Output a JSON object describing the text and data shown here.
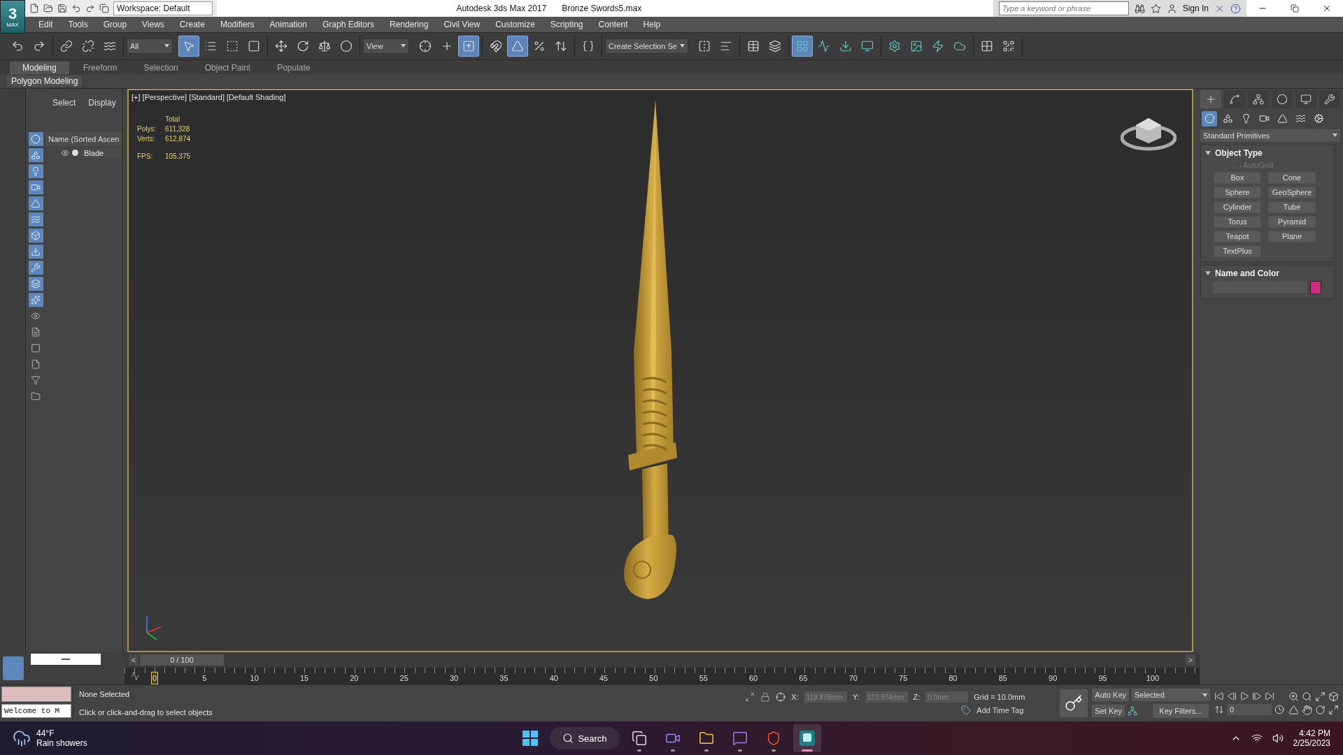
{
  "title_bar": {
    "logo": {
      "digit": "3",
      "label": "MAX"
    },
    "workspace": "Workspace: Default",
    "app": "Autodesk 3ds Max 2017",
    "file": "Bronze Swords5.max",
    "search_placeholder": "Type a keyword or phrase",
    "sign_in": "Sign In"
  },
  "menus": [
    "Edit",
    "Tools",
    "Group",
    "Views",
    "Create",
    "Modifiers",
    "Animation",
    "Graph Editors",
    "Rendering",
    "Civil View",
    "Customize",
    "Scripting",
    "Content",
    "Help"
  ],
  "main_toolbar": [
    {
      "kind": "group",
      "buttons": [
        {
          "selected": false
        },
        {
          "selected": false
        }
      ]
    },
    {
      "kind": "group",
      "buttons": [
        {
          "selected": false
        },
        {
          "selected": false
        },
        {
          "selected": false
        }
      ]
    },
    {
      "kind": "dropdown",
      "value": "All"
    },
    {
      "kind": "group",
      "buttons": [
        {
          "selected": true
        },
        {
          "selected": false
        },
        {
          "selected": false
        },
        {
          "selected": false
        }
      ]
    },
    {
      "kind": "group",
      "buttons": [
        {
          "selected": false
        },
        {
          "selected": false
        },
        {
          "selected": false
        },
        {
          "selected": false
        }
      ]
    },
    {
      "kind": "dropdown",
      "value": "View"
    },
    {
      "kind": "group",
      "buttons": [
        {
          "selected": false
        },
        {
          "selected": false
        },
        {
          "selected": true
        }
      ]
    },
    {
      "kind": "group",
      "buttons": [
        {
          "selected": false
        },
        {
          "selected": true
        },
        {
          "selected": false
        },
        {
          "selected": false
        }
      ]
    },
    {
      "kind": "group",
      "buttons": [
        {
          "selected": false
        }
      ]
    },
    {
      "kind": "dropdown",
      "value": "Create Selection Se"
    },
    {
      "kind": "group",
      "buttons": [
        {
          "selected": false
        },
        {
          "selected": false
        }
      ]
    },
    {
      "kind": "group",
      "buttons": [
        {
          "selected": false
        },
        {
          "selected": false
        }
      ]
    },
    {
      "kind": "group",
      "buttons": [
        {
          "selected": true
        },
        {
          "selected": false
        },
        {
          "selected": false
        },
        {
          "selected": false
        }
      ]
    },
    {
      "kind": "group",
      "buttons": [
        {
          "selected": false
        },
        {
          "selected": false
        },
        {
          "selected": false
        },
        {
          "selected": false
        }
      ]
    },
    {
      "kind": "group",
      "buttons": [
        {
          "selected": false
        },
        {
          "selected": false
        }
      ]
    }
  ],
  "ribbon": {
    "tabs": [
      {
        "label": "Modeling",
        "selected": true
      },
      {
        "label": "Freeform",
        "selected": false
      },
      {
        "label": "Selection",
        "selected": false
      },
      {
        "label": "Object Paint",
        "selected": false
      },
      {
        "label": "Populate",
        "selected": false
      }
    ],
    "panel": "Polygon Modeling"
  },
  "display_filters": [
    {
      "on": true
    },
    {
      "on": true
    },
    {
      "on": true
    },
    {
      "on": true
    },
    {
      "on": true
    },
    {
      "on": true
    },
    {
      "on": true
    },
    {
      "on": true
    },
    {
      "on": true
    },
    {
      "on": true
    },
    {
      "on": true
    },
    {
      "on": false
    },
    {
      "on": false
    },
    {
      "on": false
    },
    {
      "on": false
    },
    {
      "on": false
    },
    {
      "on": false
    }
  ],
  "scene_explorer": {
    "tabs": [
      "Select",
      "Display"
    ],
    "column": "Name (Sorted Ascen",
    "rows": [
      {
        "name": "Blade"
      }
    ]
  },
  "viewport": {
    "label": "[+] [Perspective] [Standard] [Default Shading]",
    "stats_header": "Total",
    "stats": [
      {
        "label": "Polys:",
        "value": "611,328"
      },
      {
        "label": "Verts:",
        "value": "612,874"
      }
    ],
    "fps": {
      "label": "FPS:",
      "value": "105.375"
    }
  },
  "command_panel": {
    "tabs": [
      {
        "selected": true
      },
      {
        "selected": false
      },
      {
        "selected": false
      },
      {
        "selected": false
      },
      {
        "selected": false
      },
      {
        "selected": false
      }
    ],
    "categories": [
      {
        "selected": true
      },
      {
        "selected": false
      },
      {
        "selected": false
      },
      {
        "selected": false
      },
      {
        "selected": false
      },
      {
        "selected": false
      },
      {
        "selected": false
      }
    ],
    "dropdown": "Standard Primitives",
    "object_type": {
      "title": "Object Type",
      "autogrid": {
        "label": "AutoGrid",
        "checked": false,
        "disabled": true
      },
      "buttons": [
        "Box",
        "Cone",
        "Sphere",
        "GeoSphere",
        "Cylinder",
        "Tube",
        "Torus",
        "Pyramid",
        "Teapot",
        "Plane",
        "TextPlus"
      ]
    },
    "name_color": {
      "title": "Name and Color",
      "color": "#c9307f"
    }
  },
  "timeline": {
    "prev": "<",
    "next": ">",
    "position": "0 / 100",
    "level": 0,
    "ticks": [
      "0",
      "5",
      "10",
      "15",
      "20",
      "25",
      "30",
      "35",
      "40",
      "45",
      "50",
      "55",
      "60",
      "65",
      "70",
      "75",
      "80",
      "85",
      "90",
      "95",
      "100"
    ]
  },
  "status": {
    "listener": "Welcome to M",
    "selection": "None Selected",
    "prompt": "Click or click-and-drag to select objects",
    "coords": [
      {
        "label": "X:",
        "value": "119.878mm"
      },
      {
        "label": "Y:",
        "value": "123.974mm"
      },
      {
        "label": "Z:",
        "value": "0.0mm"
      }
    ],
    "grid": "Grid = 10.0mm",
    "add_time_tag": "Add Time Tag",
    "auto_key": "Auto Key",
    "set_key": "Set Key",
    "key_mode": "Selected",
    "key_filters": "Key Filters...",
    "frame": "0"
  },
  "taskbar": {
    "weather": {
      "temp": "44°F",
      "condition": "Rain showers"
    },
    "search": "Search",
    "apps": [
      {
        "selected": false
      },
      {
        "selected": false
      },
      {
        "selected": false
      },
      {
        "selected": false
      },
      {
        "selected": false
      },
      {
        "selected": true
      }
    ],
    "time": "4:42 PM",
    "date": "2/25/2023"
  }
}
